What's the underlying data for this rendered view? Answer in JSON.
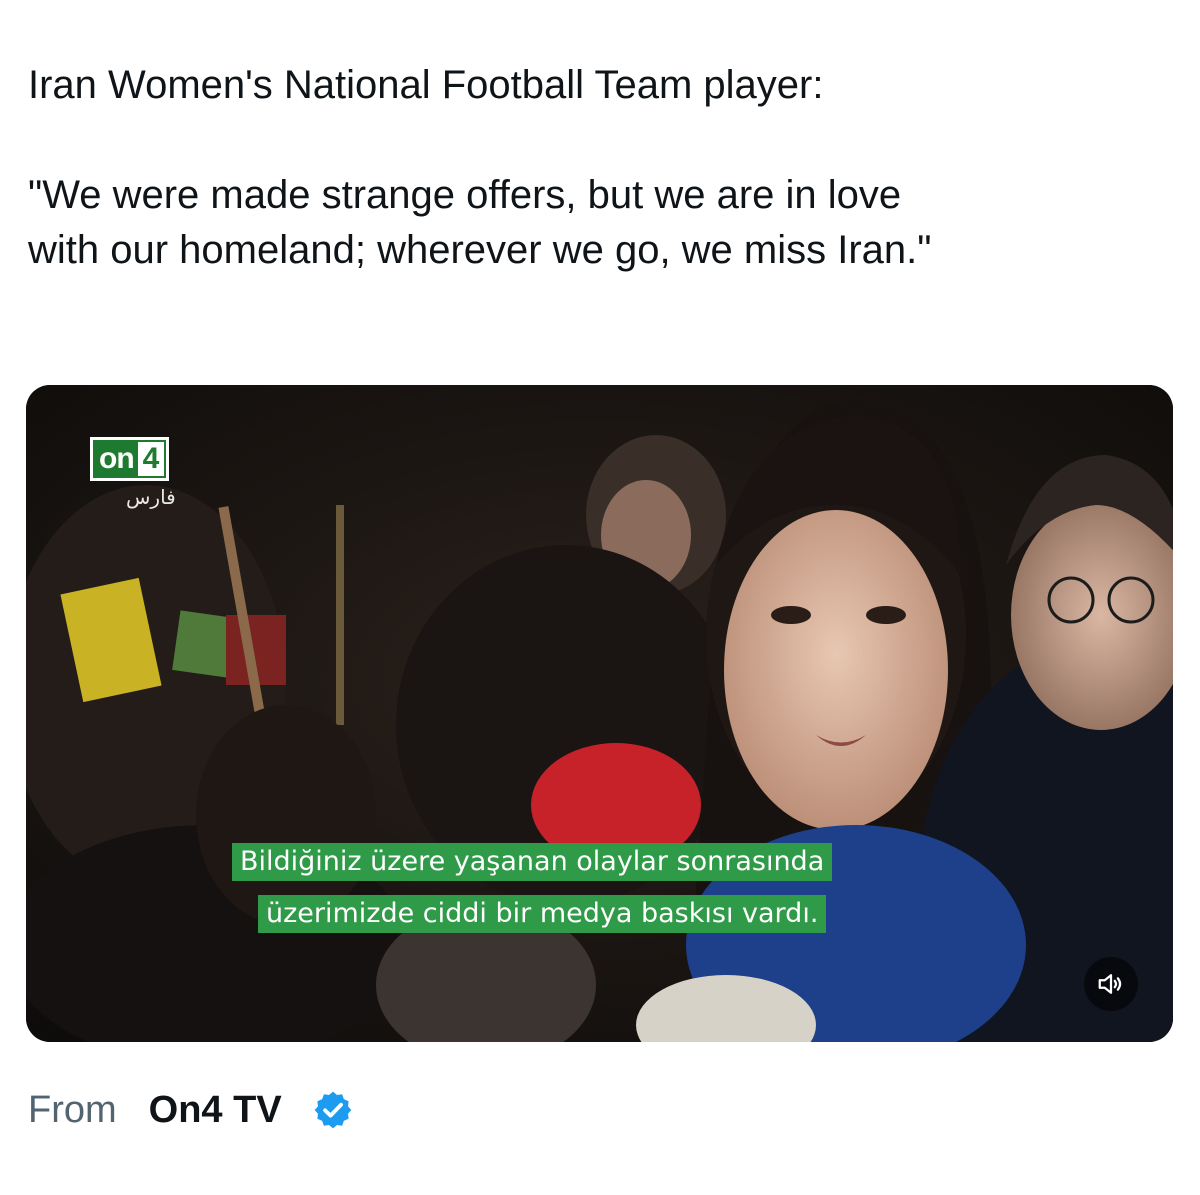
{
  "tweet": {
    "line1": "Iran Women's National Football Team player:",
    "line2": "\"We were made strange offers, but we are in love",
    "line3": "with our homeland; wherever we go, we miss Iran.\""
  },
  "video": {
    "logo_text": "on",
    "logo_number": "4",
    "watermark": "فارس",
    "subtitle_line1": "Bildiğiniz üzere yaşanan olaylar sonrasında",
    "subtitle_line2": "üzerimizde ciddi bir medya baskısı vardı.",
    "volume_icon": "speaker-icon",
    "subtitle_color": "#2f9a48"
  },
  "source": {
    "from_label": "From",
    "account_name": "On4 TV",
    "badge_icon": "verified-badge-icon",
    "badge_color": "#1d9bf0"
  }
}
